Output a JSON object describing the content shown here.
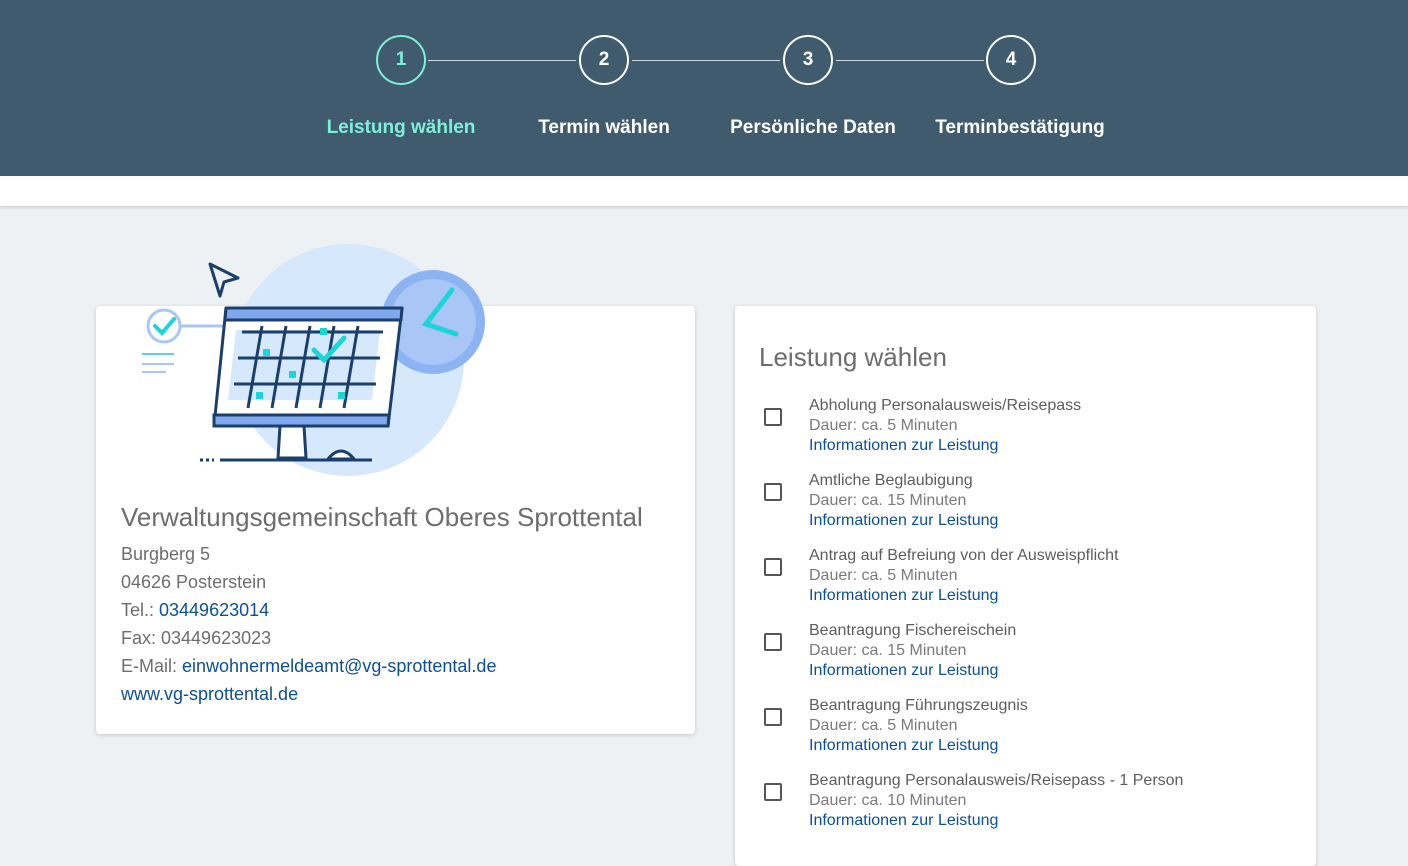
{
  "stepper": {
    "steps": [
      {
        "number": "1",
        "label": "Leistung wählen",
        "active": true
      },
      {
        "number": "2",
        "label": "Termin wählen",
        "active": false
      },
      {
        "number": "3",
        "label": "Persönliche Daten",
        "active": false
      },
      {
        "number": "4",
        "label": "Terminbestätigung",
        "active": false
      }
    ]
  },
  "office": {
    "name": "Verwaltungsgemeinschaft Oberes Sprottental",
    "street": "Burgberg 5",
    "city": "04626 Posterstein",
    "tel_label": "Tel.: ",
    "tel": "03449623014",
    "fax_label": "Fax: ",
    "fax": "03449623023",
    "email_label": "E-Mail: ",
    "email": "einwohnermeldeamt@vg-sprottental.de",
    "website": "www.vg-sprottental.de"
  },
  "services": {
    "title": "Leistung wählen",
    "info_link_label": "Informationen zur Leistung",
    "items": [
      {
        "name": "Abholung Personalausweis/Reisepass",
        "duration": "Dauer: ca. 5 Minuten",
        "info": "Informationen zur Leistung"
      },
      {
        "name": "Amtliche Beglaubigung",
        "duration": "Dauer: ca. 15 Minuten",
        "info": "Informationen zur Leistung"
      },
      {
        "name": "Antrag auf Befreiung von der Ausweispflicht",
        "duration": "Dauer: ca. 5 Minuten",
        "info": "Informationen zur Leistung"
      },
      {
        "name": "Beantragung Fischereischein",
        "duration": "Dauer: ca. 15 Minuten",
        "info": "Informationen zur Leistung"
      },
      {
        "name": "Beantragung Führungszeugnis",
        "duration": "Dauer: ca. 5 Minuten",
        "info": "Informationen zur Leistung"
      },
      {
        "name": "Beantragung Personalausweis/Reisepass - 1 Person",
        "duration": "Dauer: ca. 10 Minuten",
        "info": "Informationen zur Leistung"
      }
    ]
  },
  "colors": {
    "header_bg": "#3f5b6d",
    "active_step": "#7ff0d8",
    "link": "#0b4e9c",
    "page_bg": "#eef1f4"
  }
}
